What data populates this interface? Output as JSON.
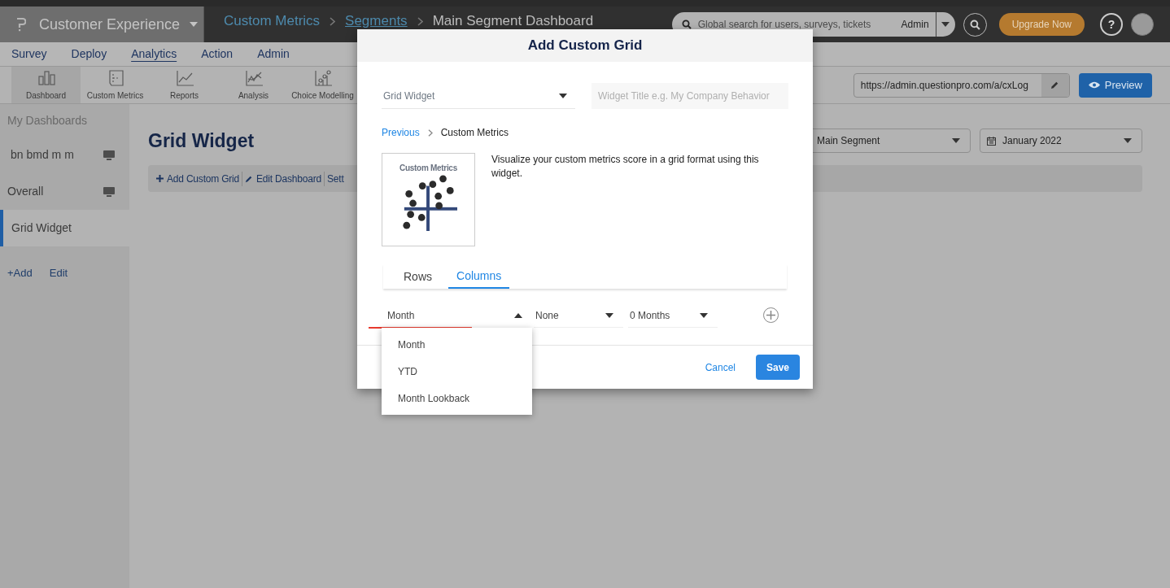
{
  "app_switcher": {
    "label": "Customer Experience"
  },
  "breadcrumbs": [
    {
      "label": "Custom Metrics",
      "kind": "link"
    },
    {
      "label": "Segments",
      "kind": "link"
    },
    {
      "label": "Main Segment Dashboard",
      "kind": "current"
    }
  ],
  "search": {
    "placeholder": "Global search for users, surveys, tickets",
    "scope": "Admin"
  },
  "upgrade_button": "Upgrade Now",
  "help_button": "?",
  "nav": [
    {
      "label": "Survey",
      "selected": false
    },
    {
      "label": "Deploy",
      "selected": false
    },
    {
      "label": "Analytics",
      "selected": true
    },
    {
      "label": "Action",
      "selected": false
    },
    {
      "label": "Admin",
      "selected": false
    }
  ],
  "toolbar": [
    {
      "label": "Dashboard",
      "selected": true
    },
    {
      "label": "Custom Metrics",
      "selected": false
    },
    {
      "label": "Reports",
      "selected": false
    },
    {
      "label": "Analysis",
      "selected": false
    },
    {
      "label": "Choice Modelling",
      "selected": false
    }
  ],
  "share_url": "https://admin.questionpro.com/a/cxLog",
  "preview_button": "Preview",
  "sidebar": {
    "heading": "My Dashboards",
    "items": [
      {
        "label": "bn bmd m m",
        "selected": false,
        "monitor": true
      },
      {
        "label": "Overall",
        "selected": false,
        "monitor": true
      },
      {
        "label": "Grid Widget",
        "selected": true,
        "monitor": false
      }
    ],
    "add_link": "+Add",
    "edit_link": "Edit"
  },
  "page": {
    "title": "Grid Widget",
    "segment": "Main Segment",
    "period": "January 2022",
    "actions": [
      {
        "label": "Add Custom Grid"
      },
      {
        "label": "Edit Dashboard"
      },
      {
        "label": "Sett"
      }
    ]
  },
  "dialog": {
    "title": "Add Custom Grid",
    "widget_type": "Grid Widget",
    "title_placeholder": "Widget Title e.g. My Company Behavior",
    "breadcrumb": {
      "back": "Previous",
      "current": "Custom Metrics"
    },
    "thumbnail_label": "Custom Metrics",
    "description": "Visualize your custom metrics score in a grid format using this widget.",
    "tabs": [
      {
        "label": "Rows",
        "selected": false
      },
      {
        "label": "Columns",
        "selected": true
      }
    ],
    "fields": [
      {
        "value": "Month",
        "open": true,
        "options": [
          "Month",
          "YTD",
          "Month Lookback"
        ]
      },
      {
        "value": "None",
        "open": false
      },
      {
        "value": "0 Months",
        "open": false
      }
    ],
    "cancel": "Cancel",
    "save": "Save"
  }
}
